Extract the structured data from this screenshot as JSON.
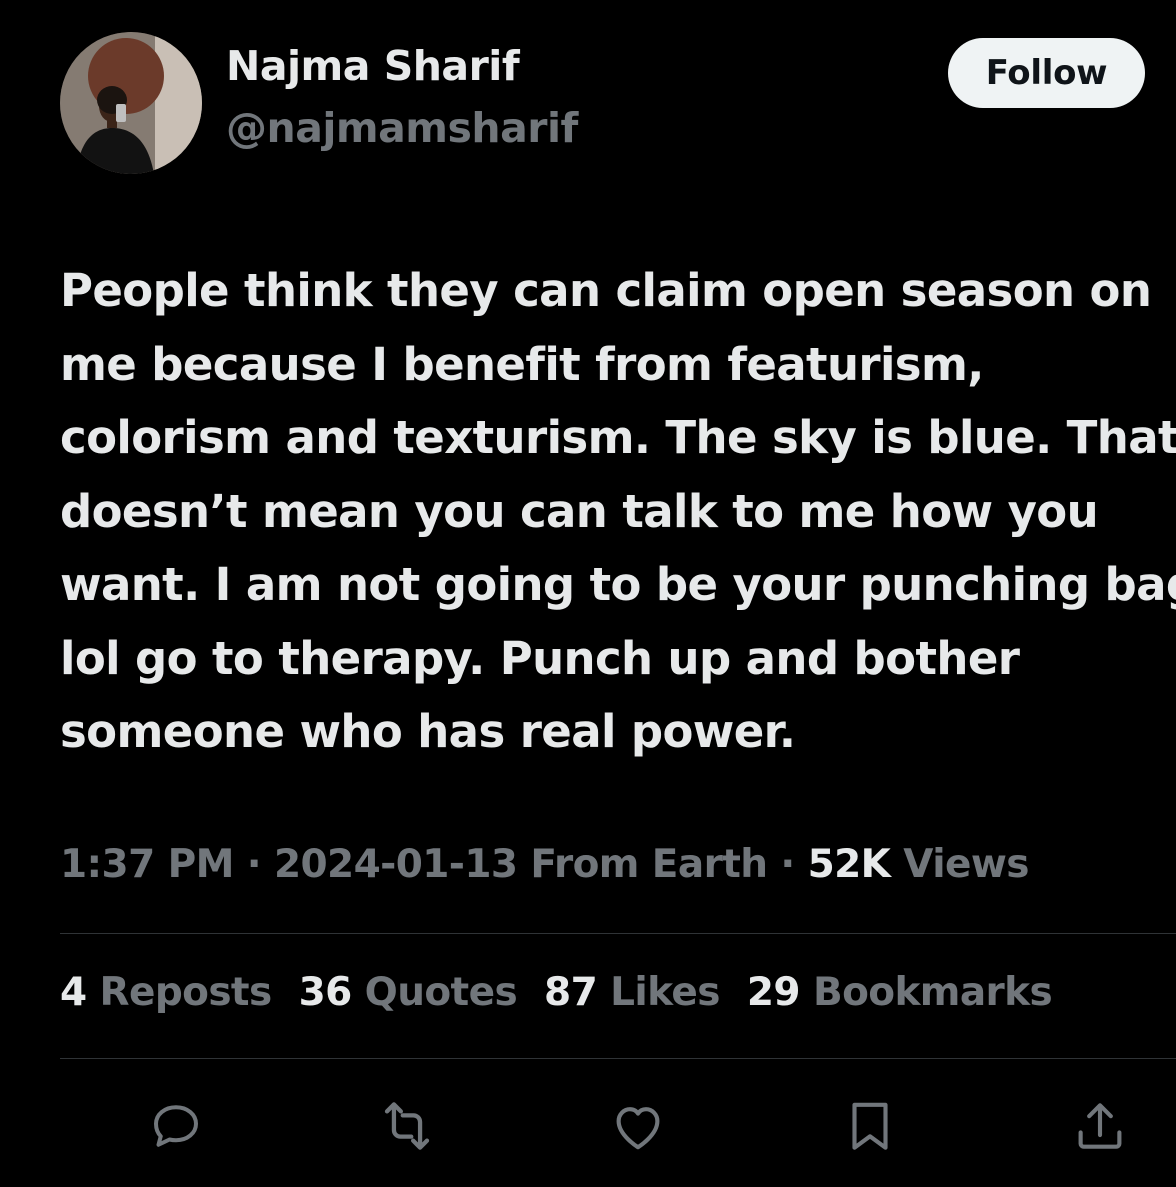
{
  "author": {
    "display_name": "Najma Sharif",
    "handle": "@najmamsharif",
    "avatar_icon": "profile-photo"
  },
  "follow_label": "Follow",
  "tweet": {
    "lines": [
      "People think they can claim open season on",
      "me because I benefit from featurism,",
      "colorism and texturism. The sky is blue. That",
      "doesn’t mean you can talk to me how you",
      "want. I am not going to be your punching bag",
      "lol go to therapy. Punch up and bother",
      "someone who has real power."
    ]
  },
  "meta": {
    "time": "1:37 PM",
    "sep1": "·",
    "date": "2024-01-13",
    "location": "From Earth",
    "sep2": "·",
    "views_count": "52K",
    "views_label": "Views"
  },
  "stats": [
    {
      "count": "4",
      "label": "Reposts"
    },
    {
      "count": "36",
      "label": "Quotes"
    },
    {
      "count": "87",
      "label": "Likes"
    },
    {
      "count": "29",
      "label": "Bookmarks"
    }
  ],
  "actions": [
    "reply-icon",
    "repost-icon",
    "like-icon",
    "bookmark-icon",
    "share-icon"
  ],
  "colors": {
    "background": "#000000",
    "text_primary": "#e7e9ea",
    "text_secondary": "#71767b",
    "divider": "#2f3336",
    "follow_bg": "#eff3f4"
  }
}
